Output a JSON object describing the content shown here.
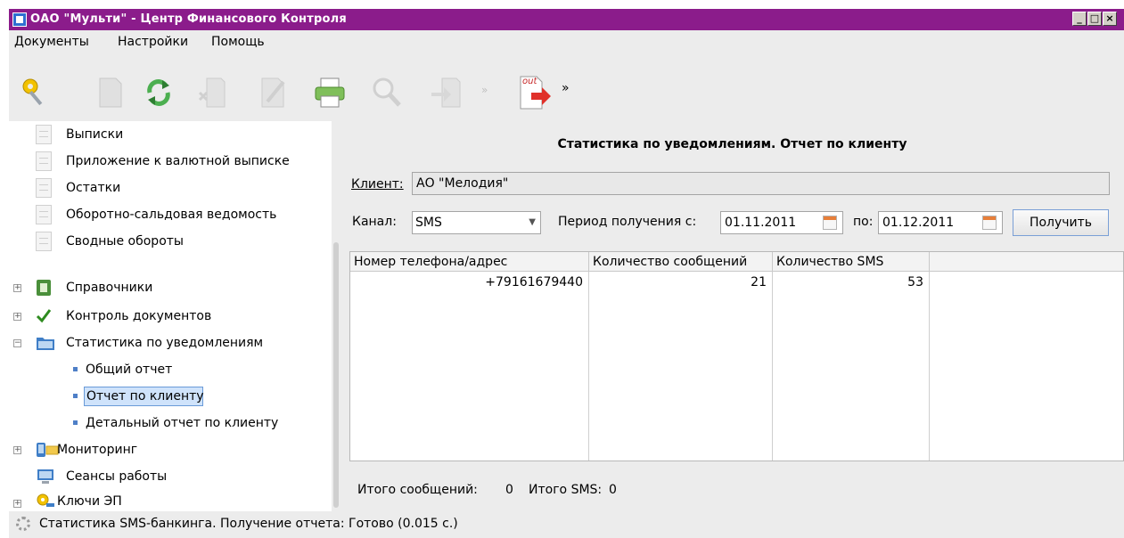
{
  "window": {
    "title": "ОАО \"Мульти\" - Центр Финансового Контроля",
    "controls": {
      "minimize": "_",
      "maximize": "□",
      "close": "×"
    }
  },
  "menu": {
    "items": [
      "Документы",
      "Настройки",
      "Помощь"
    ]
  },
  "toolbar": {
    "buttons": [
      "key-icon",
      "document-icon",
      "refresh-icon",
      "delete-icon",
      "edit-icon",
      "printer-icon",
      "search-icon",
      "import-icon",
      "export-out-icon"
    ],
    "export_badge": "out",
    "overflow_glyph": "»"
  },
  "sidebar": {
    "docs": [
      "Выписки",
      "Приложение к валютной выписке",
      "Остатки",
      "Оборотно-сальдовая ведомость",
      "Сводные обороты"
    ],
    "groups": {
      "directories": "Справочники",
      "doc_control": "Контроль документов",
      "notifications": "Статистика по уведомлениям",
      "monitoring": "Мониторинг",
      "sessions": "Сеансы работы",
      "ep_keys": "Ключи ЭП"
    },
    "notif_children": [
      "Общий отчет",
      "Отчет по клиенту",
      "Детальный отчет по клиенту"
    ],
    "selected_child": "Отчет по клиенту"
  },
  "report": {
    "title": "Статистика по уведомлениям. Отчет по клиенту",
    "client_label": "Клиент:",
    "client_value": "АО \"Мелодия\"",
    "channel_label": "Канал:",
    "channel_value": "SMS",
    "period_label": "Период получения с:",
    "date_from": "01.11.2011",
    "to_label": "по:",
    "date_to": "01.12.2011",
    "get_button": "Получить"
  },
  "table": {
    "columns": [
      "Номер телефона/адрес",
      "Количество сообщений",
      "Количество SMS"
    ],
    "rows": [
      [
        "+79161679440",
        "21",
        "53"
      ]
    ]
  },
  "totals": {
    "messages_label": "Итого сообщений:",
    "messages_value": "0",
    "sms_label": "Итого SMS:",
    "sms_value": "0"
  },
  "status": {
    "text": "Статистика SMS-банкинга. Получение отчета: Готово (0.015 с.)"
  },
  "colors": {
    "titlebar": "#8b1c8b",
    "selection": "#cfe3fb",
    "accent": "#4e7fc7"
  }
}
